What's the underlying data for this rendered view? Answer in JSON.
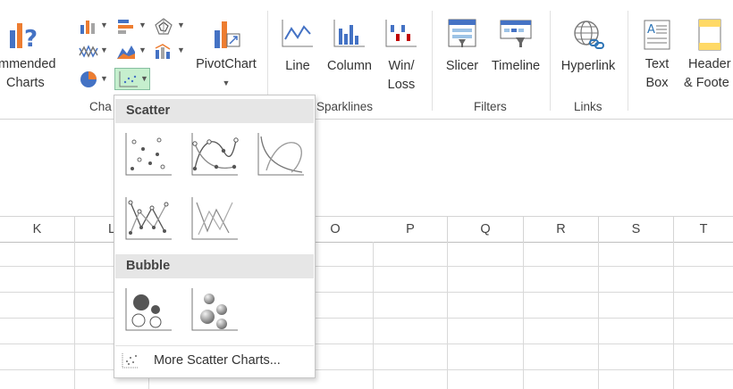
{
  "ribbon": {
    "groups": {
      "charts": "Cha",
      "sparklines": "Sparklines",
      "filters": "Filters",
      "links": "Links"
    },
    "buttons": {
      "recommended_charts_line1": "mmended",
      "recommended_charts_line2": "Charts",
      "pivotchart": "PivotChart",
      "line": "Line",
      "column": "Column",
      "winloss_line1": "Win/",
      "winloss_line2": "Loss",
      "slicer": "Slicer",
      "timeline": "Timeline",
      "hyperlink": "Hyperlink",
      "textbox_line1": "Text",
      "textbox_line2": "Box",
      "header_line1": "Header",
      "header_line2": "& Foote"
    },
    "accent_color": "#217346"
  },
  "grid": {
    "columns": [
      "K",
      "L",
      "O",
      "P",
      "Q",
      "R",
      "S",
      "T"
    ]
  },
  "scatter_menu": {
    "section_scatter": "Scatter",
    "section_bubble": "Bubble",
    "more_link": "More Scatter Charts...",
    "scatter_items": [
      "Scatter",
      "Scatter with Smooth Lines and Markers",
      "Scatter with Smooth Lines",
      "Scatter with Straight Lines and Markers",
      "Scatter with Straight Lines"
    ],
    "bubble_items": [
      "Bubble",
      "3-D Bubble"
    ]
  }
}
